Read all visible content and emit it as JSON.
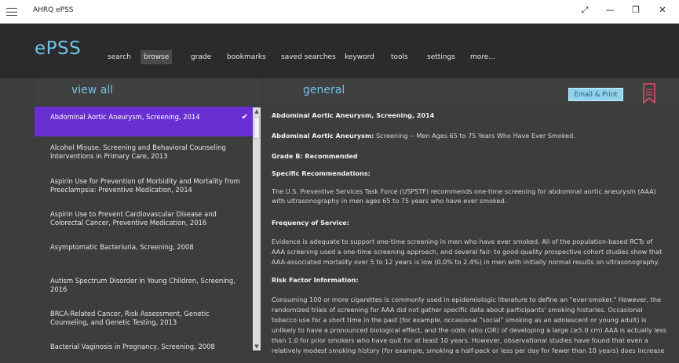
{
  "window": {
    "title": "AHRQ ePSS",
    "controls": [
      "⤢",
      "—",
      "❐",
      "✕"
    ]
  },
  "app": {
    "logo": "ePSS"
  },
  "nav": {
    "items": [
      "search",
      "browse",
      "grade",
      "bookmarks",
      "saved searches",
      "keyword",
      "tools",
      "settings",
      "more..."
    ],
    "active": "browse"
  },
  "left": {
    "header": "view all",
    "items": [
      [
        "Abdominal Aortic Aneurysm, Screening, 2014"
      ],
      [
        "Alcohol Misuse, Screening and Behavioral Counseling",
        "Interventions in Primary Care, 2013"
      ],
      [
        "Aspirin Use for Prevention of Morbidity and Mortality from",
        "Preeclampsia: Preventive Medication, 2014"
      ],
      [
        "Aspirin Use to Prevent Cardiovascular Disease and",
        "Colorectal Cancer, Preventive Medication, 2016"
      ],
      [
        "Asymptomatic Bacteriuria, Screening, 2008"
      ],
      [
        "Autism Spectrum Disorder in Young Children, Screening,",
        "2016"
      ],
      [
        "BRCA-Related Cancer, Risk Assessment, Genetic",
        "Counseling, and Genetic Testing, 2013"
      ],
      [
        "Bacterial Vaginosis in Pregnancy, Screening, 2008"
      ]
    ],
    "selected_check": "✔"
  },
  "right": {
    "header": "general",
    "email_print": "Email & Print",
    "title": "Abdominal Aortic Aneurysm, Screening, 2014",
    "population_label": "Abdominal Aortic Aneurysm:",
    "population_text": " Screening -- Men Ages 65 to 75 Years Who Have Ever Smoked.",
    "grade": "Grade B: Recommended",
    "specific_heading": "Specific Recommendations:",
    "specific_lines": [
      "The U.S. Preventive Services Task Force (USPSTF) recommends one-time screening for abdominal aortic aneurysm (AAA)",
      "with ultrasonography in men ages 65 to 75 years who have ever smoked."
    ],
    "frequency_heading": "Frequency of Service:",
    "frequency_lines": [
      "Evidence is adequate to support one-time screening in men who have ever smoked. All of the population-based RCTs of",
      "AAA screening used a one-time screening approach, and several fair- to good-quality prospective cohort studies show that",
      "AAA-associated mortality over 5 to 12 years is low (0.0% to 2.4%) in men with initially normal results on ultrasonography."
    ],
    "risk_heading": "Risk Factor Information:",
    "risk_lines": [
      "Consuming 100 or more cigarettes is commonly used in epidemiologic literature to define an \"ever-smoker.\" However, the",
      "randomized trials of screening for AAA did not gather specific data about participants' smoking histories. Occasional",
      "tobacco use for a short time in the past (for example, occasional \"social\" smoking as an adolescent or young adult) is",
      "unlikely to have a pronounced biological effect, and the odds ratio (OR) of developing a large (≥5.0 cm) AAA is actually less",
      "than 1.0 for prior smokers who have quit for at least 10 years. However, observational studies have found that even a",
      "relatively modest smoking history (for example, smoking a half-pack or less per day for fewer than 10 years) does increase"
    ]
  },
  "colors": {
    "accent": "#6fc3e8",
    "selected": "#6a2fd3",
    "bookmark": "#e0506a"
  }
}
